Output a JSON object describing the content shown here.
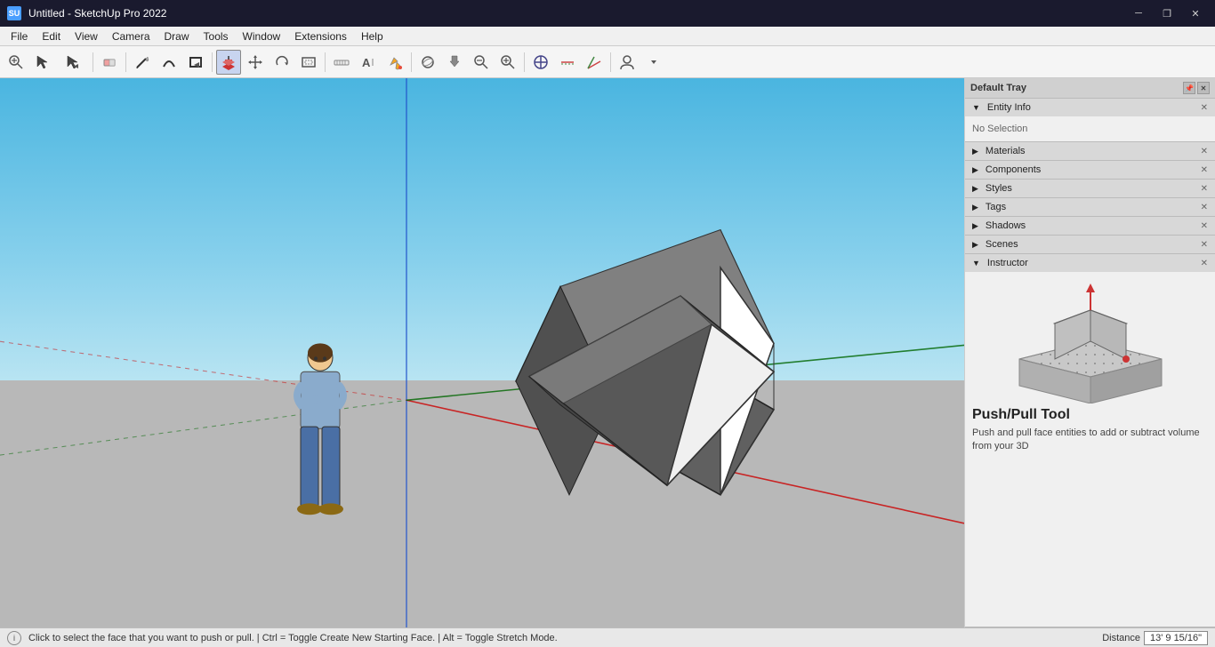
{
  "titlebar": {
    "title": "Untitled - SketchUp Pro 2022",
    "app_icon": "SU",
    "minimize_label": "─",
    "restore_label": "❐",
    "close_label": "✕"
  },
  "menubar": {
    "items": [
      "File",
      "Edit",
      "View",
      "Camera",
      "Draw",
      "Tools",
      "Window",
      "Extensions",
      "Help"
    ]
  },
  "toolbar": {
    "tools": [
      {
        "name": "zoom-extents",
        "icon": "🔍",
        "label": "Zoom Extents"
      },
      {
        "name": "select",
        "icon": "↖",
        "label": "Select"
      },
      {
        "name": "eraser",
        "icon": "◻",
        "label": "Eraser"
      },
      {
        "name": "pencil",
        "icon": "✏",
        "label": "Pencil"
      },
      {
        "name": "shape",
        "icon": "◻",
        "label": "Shape"
      },
      {
        "name": "rectangle",
        "icon": "▭",
        "label": "Rectangle"
      },
      {
        "name": "push-pull",
        "icon": "⬆",
        "label": "Push/Pull"
      },
      {
        "name": "move",
        "icon": "✛",
        "label": "Move"
      },
      {
        "name": "rotate",
        "icon": "↺",
        "label": "Rotate"
      },
      {
        "name": "offset",
        "icon": "⬢",
        "label": "Offset"
      },
      {
        "name": "tape",
        "icon": "📏",
        "label": "Tape Measure"
      },
      {
        "name": "text",
        "icon": "A",
        "label": "Text"
      },
      {
        "name": "paint",
        "icon": "🪣",
        "label": "Paint Bucket"
      },
      {
        "name": "orbit",
        "icon": "🌐",
        "label": "Orbit"
      },
      {
        "name": "pan",
        "icon": "✋",
        "label": "Pan"
      },
      {
        "name": "zoom",
        "icon": "🔎",
        "label": "Zoom"
      },
      {
        "name": "zoom-window",
        "icon": "⊕",
        "label": "Zoom Window"
      },
      {
        "name": "section-plane",
        "icon": "⬡",
        "label": "Section Plane"
      },
      {
        "name": "walk",
        "icon": "⚑",
        "label": "Walk"
      },
      {
        "name": "position-camera",
        "icon": "⚐",
        "label": "Position Camera"
      },
      {
        "name": "profile",
        "icon": "👤",
        "label": "Profile"
      }
    ]
  },
  "viewport": {
    "bg_sky_top": "#3baad8",
    "bg_sky_bottom": "#9dd9f0",
    "bg_ground": "#b0b0b0"
  },
  "right_panel": {
    "tray_title": "Default Tray",
    "sections": [
      {
        "name": "entity-info",
        "label": "Entity Info",
        "expanded": true,
        "content": {
          "no_selection": "No Selection"
        }
      },
      {
        "name": "materials",
        "label": "Materials",
        "expanded": false
      },
      {
        "name": "components",
        "label": "Components",
        "expanded": false
      },
      {
        "name": "styles",
        "label": "Styles",
        "expanded": false
      },
      {
        "name": "tags",
        "label": "Tags",
        "expanded": false
      },
      {
        "name": "shadows",
        "label": "Shadows",
        "expanded": false
      },
      {
        "name": "scenes",
        "label": "Scenes",
        "expanded": false
      },
      {
        "name": "instructor",
        "label": "Instructor",
        "expanded": true
      }
    ]
  },
  "instructor": {
    "tool_name": "Push/Pull Tool",
    "description": "Push and pull face entities to add or subtract volume from your 3D"
  },
  "statusbar": {
    "info_icon": "i",
    "status_text": "Click to select the face that you want to push or pull. | Ctrl = Toggle Create New Starting Face. | Alt = Toggle Stretch Mode.",
    "measurement_label": "Distance",
    "measurement_value": "13' 9 15/16\""
  }
}
